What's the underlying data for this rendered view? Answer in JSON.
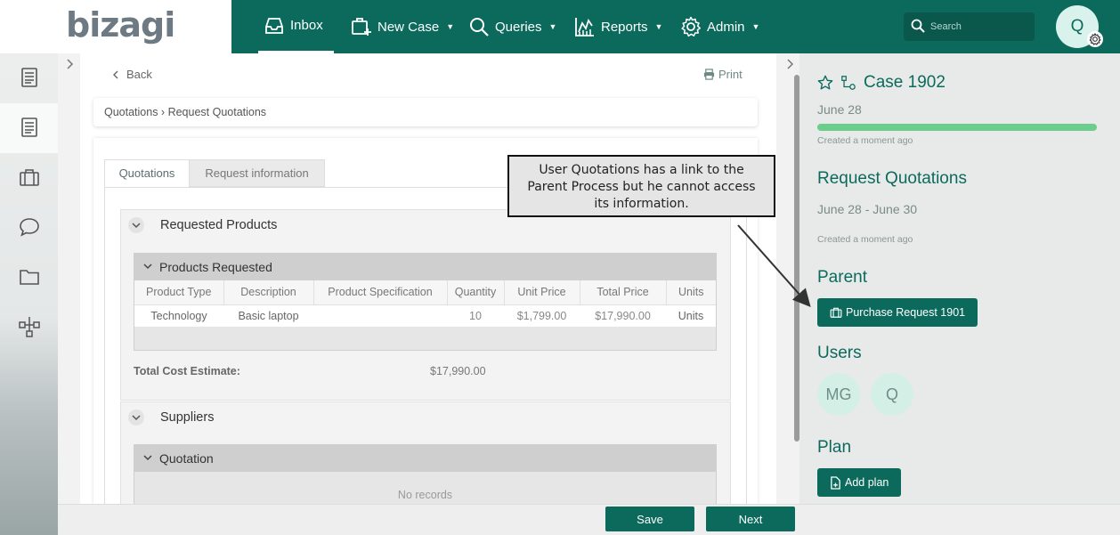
{
  "brand": {
    "logo_text": "bizagi"
  },
  "topnav": {
    "items": [
      {
        "label": "Inbox",
        "icon": "inbox-icon"
      },
      {
        "label": "New Case",
        "icon": "new-case-icon"
      },
      {
        "label": "Queries",
        "icon": "search-icon"
      },
      {
        "label": "Reports",
        "icon": "reports-icon"
      },
      {
        "label": "Admin",
        "icon": "gear-icon"
      }
    ],
    "search_placeholder": "Search",
    "user_initial": "Q"
  },
  "sidebar": {
    "items": [
      "work-items-icon",
      "inbox-list-icon",
      "briefcase-icon",
      "chat-icon",
      "folder-icon",
      "process-map-icon"
    ]
  },
  "main": {
    "back_label": "Back",
    "print_label": "Print",
    "breadcrumb": "Quotations › Request Quotations",
    "tabs": [
      {
        "label": "Quotations",
        "active": true
      },
      {
        "label": "Request information",
        "active": false
      }
    ],
    "requested_products": {
      "title": "Requested Products",
      "grid_title": "Products Requested",
      "columns": [
        "Product Type",
        "Description",
        "Product Specification",
        "Quantity",
        "Unit Price",
        "Total Price",
        "Units"
      ],
      "rows": [
        [
          "Technology",
          "Basic laptop",
          "",
          "10",
          "$1,799.00",
          "$17,990.00",
          "Units"
        ]
      ],
      "total_label": "Total Cost Estimate:",
      "total_value": "$17,990.00"
    },
    "suppliers": {
      "title": "Suppliers",
      "grid_title": "Quotation",
      "empty_text": "No records"
    }
  },
  "callout": {
    "text": "User Quotations has a link to the Parent Process but he cannot access its information."
  },
  "right_panel": {
    "case_title": "Case 1902",
    "case_date": "June 28",
    "case_progress": 1.0,
    "case_created": "Created a moment ago",
    "task_title": "Request Quotations",
    "task_dates": "June 28 - June 30",
    "task_created": "Created a moment ago",
    "parent_heading": "Parent",
    "parent_button": "Purchase Request 1901",
    "users_heading": "Users",
    "users": [
      "MG",
      "Q"
    ],
    "plan_heading": "Plan",
    "plan_button": "Add plan"
  },
  "actions": {
    "save": "Save",
    "next": "Next"
  },
  "colors": {
    "primary": "#0c6a5d",
    "progress": "#6cce8c",
    "panel": "#e8eaea"
  }
}
